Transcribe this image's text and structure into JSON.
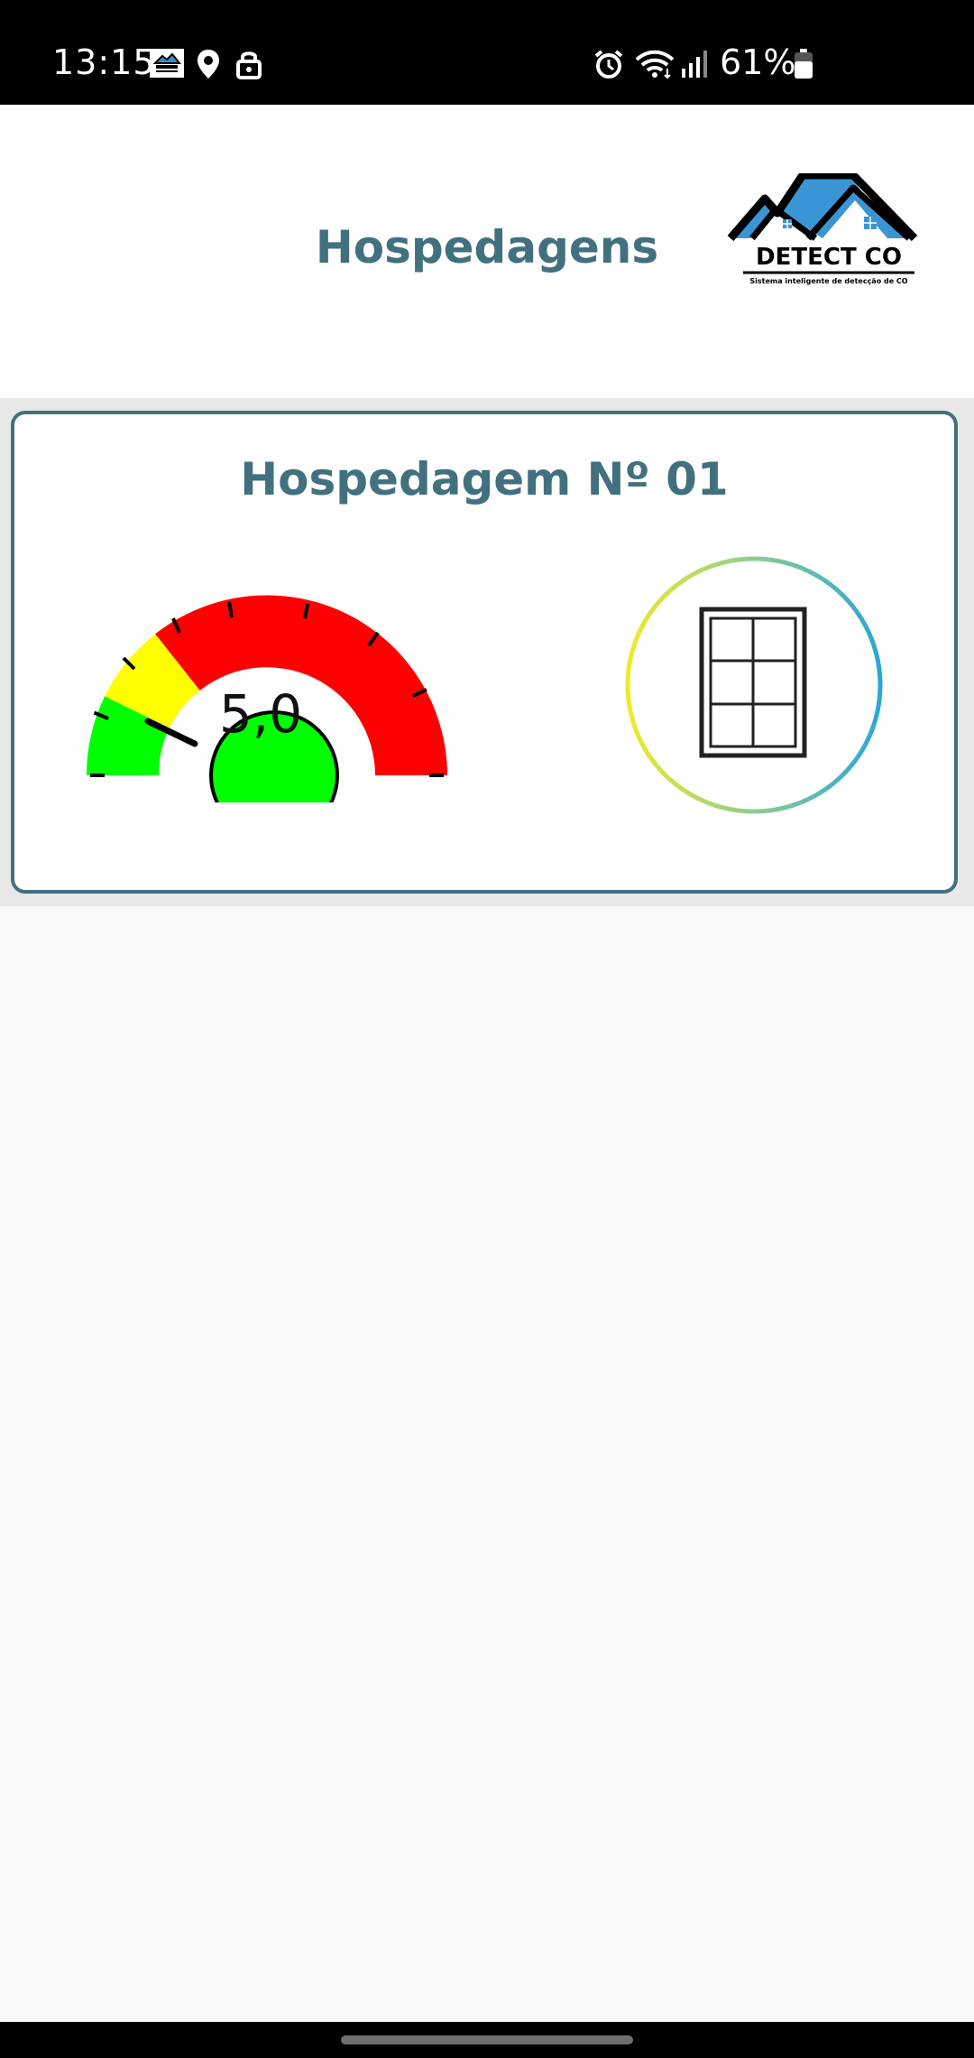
{
  "status_bar": {
    "time": "13:15",
    "battery": "61%",
    "icons": [
      "app-logo-icon",
      "location-icon",
      "lock-icon",
      "alarm-icon",
      "wifi-icon",
      "signal-icon",
      "battery-icon"
    ]
  },
  "header": {
    "title": "Hospedagens",
    "logo": {
      "name": "DETECT CO",
      "tagline": "Sistema inteligente de detecção de CO"
    }
  },
  "lodging": {
    "title": "Hospedagem Nº 01",
    "gauge": {
      "value": 5.0,
      "display": "5,0",
      "zones": [
        "green",
        "yellow",
        "red"
      ],
      "colors": {
        "green": "#00ff00",
        "yellow": "#ffff00",
        "red": "#ff0000"
      }
    },
    "window_icon": "window-icon"
  },
  "colors": {
    "accent": "#41707f",
    "status_bar": "#000000",
    "page_background": "#f9f9f9"
  }
}
